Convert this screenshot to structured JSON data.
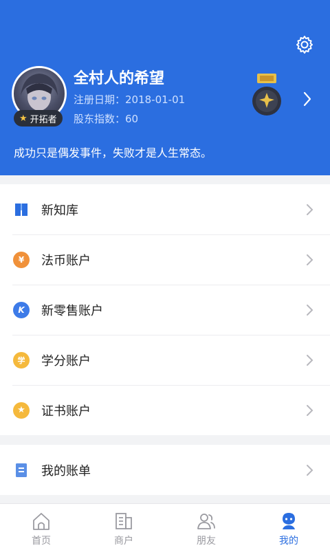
{
  "profile": {
    "username": "全村人的希望",
    "reg_date": "注册日期：2018-01-01",
    "share_index": "股东指数：60",
    "badge": "开拓者",
    "motto": "成功只是偶发事件，失败才是人生常态。"
  },
  "menu_group1": [
    {
      "label": "新知库",
      "icon": "book-icon"
    },
    {
      "label": "法币账户",
      "icon": "yuan-icon",
      "icon_text": "¥",
      "color": "#f0913a"
    },
    {
      "label": "新零售账户",
      "icon": "k-icon",
      "icon_text": "K",
      "color": "#3d7be8"
    },
    {
      "label": "学分账户",
      "icon": "credit-icon",
      "icon_text": "学",
      "color": "#f5b93c"
    },
    {
      "label": "证书账户",
      "icon": "certificate-icon",
      "icon_text": "★",
      "color": "#f5b93c"
    }
  ],
  "menu_group2": [
    {
      "label": "我的账单",
      "icon": "bill-icon"
    }
  ],
  "tabs": [
    {
      "label": "首页",
      "icon": "home-icon"
    },
    {
      "label": "商户",
      "icon": "merchant-icon"
    },
    {
      "label": "朋友",
      "icon": "friends-icon"
    },
    {
      "label": "我的",
      "icon": "me-icon",
      "active": true
    }
  ],
  "colors": {
    "accent": "#2b6ee0"
  }
}
